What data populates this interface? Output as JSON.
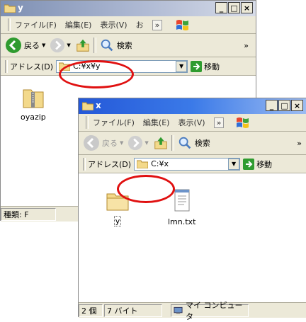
{
  "win_y": {
    "title": "y",
    "menu": [
      "ファイル(F)",
      "編集(E)",
      "表示(V)",
      "お"
    ],
    "menu_more": "»",
    "toolbar": {
      "back": "戻る",
      "search": "検索",
      "more": "»"
    },
    "address": {
      "label": "アドレス(D)",
      "value": "C:¥x¥y",
      "go": "移動"
    },
    "files": [
      {
        "name": "oyazip"
      }
    ],
    "status": {
      "text": "種類: F"
    }
  },
  "win_x": {
    "title": "x",
    "menu": [
      "ファイル(F)",
      "編集(E)",
      "表示(V)"
    ],
    "menu_more": "»",
    "toolbar": {
      "back": "戻る",
      "search": "検索",
      "more": "»"
    },
    "address": {
      "label": "アドレス(D)",
      "value": "C:¥x",
      "go": "移動"
    },
    "files": [
      {
        "name": "y"
      },
      {
        "name": "lmn.txt"
      }
    ],
    "status": {
      "count": "2 個",
      "size": "7 バイト",
      "location": "マイ コンピュータ"
    }
  },
  "captions": {
    "minimize": "_",
    "maximize": "□",
    "close": "×"
  },
  "highlight_color": "#e01010"
}
